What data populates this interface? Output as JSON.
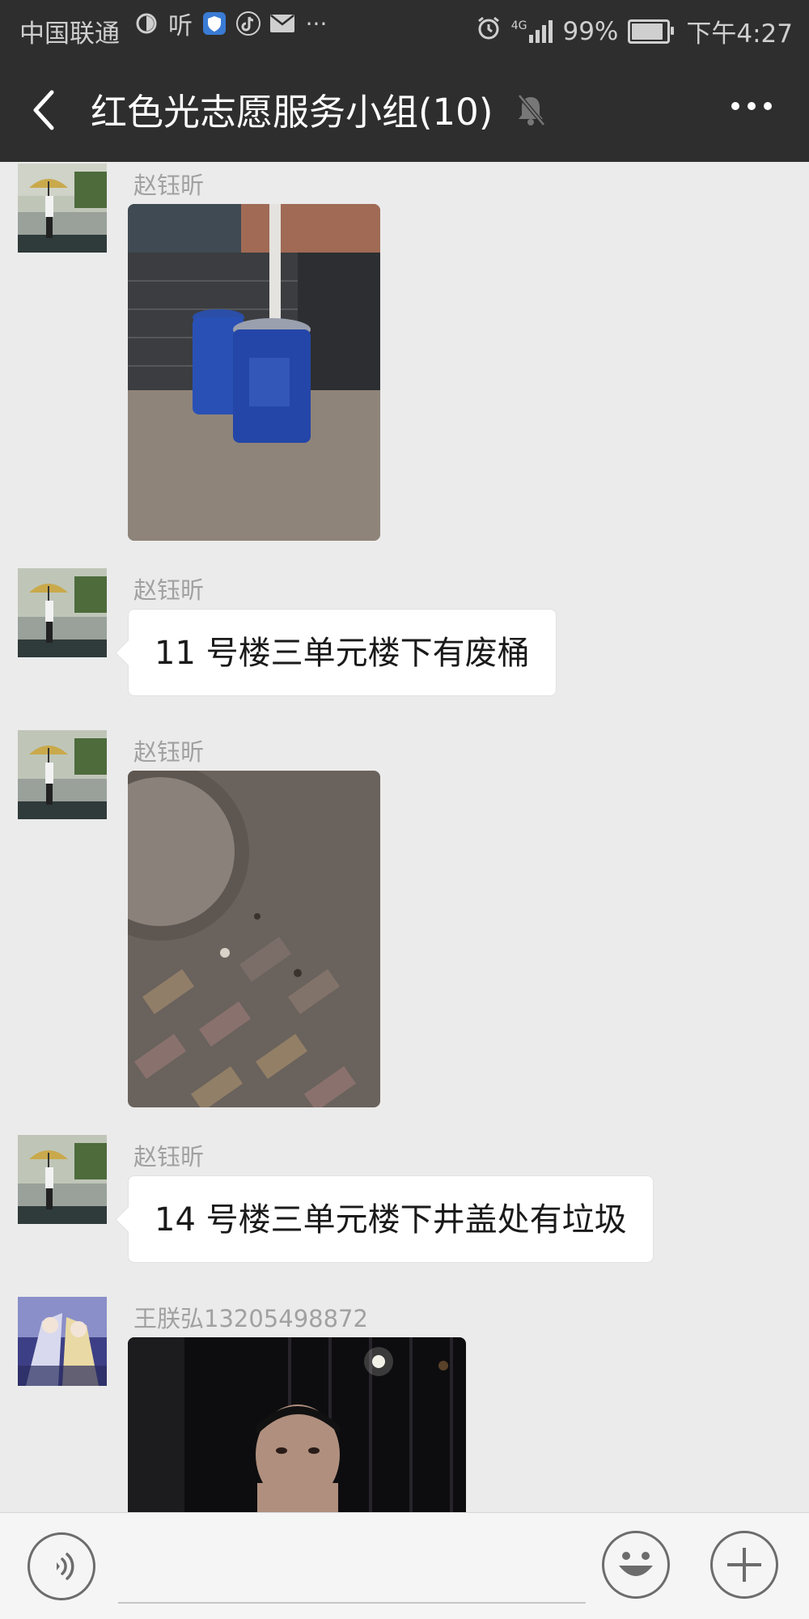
{
  "status_bar": {
    "carrier": "中国联通",
    "battery": "99%",
    "battery_level": 0.99,
    "time": "下午4:27",
    "network": "4G"
  },
  "header": {
    "title": "红色光志愿服务小组(10)"
  },
  "messages": [
    {
      "sender": "赵钰昕",
      "type": "image",
      "image": "blue-barrels-photo"
    },
    {
      "sender": "赵钰昕",
      "type": "text",
      "text": "11 号楼三单元楼下有废桶"
    },
    {
      "sender": "赵钰昕",
      "type": "image",
      "image": "manhole-cover-photo"
    },
    {
      "sender": "赵钰昕",
      "type": "text",
      "text": "14 号楼三单元楼下井盖处有垃圾"
    },
    {
      "sender": "王朕弘13205498872",
      "type": "image",
      "image": "night-selfie-photo"
    }
  ],
  "input": {
    "placeholder": ""
  },
  "colors": {
    "header_bg": "#2e2e2e",
    "chat_bg": "#ebebeb",
    "bubble_bg": "#ffffff",
    "sender_text": "#a1a1a1"
  }
}
